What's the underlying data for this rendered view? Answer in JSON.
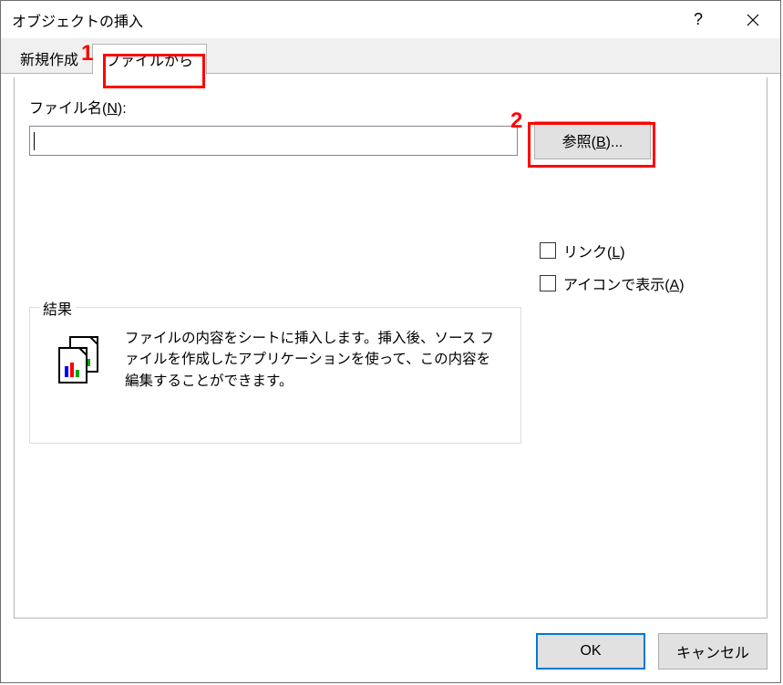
{
  "window": {
    "title": "オブジェクトの挿入",
    "help": "?",
    "close": "✕"
  },
  "tabs": {
    "new": "新規作成",
    "file": "ファイルから"
  },
  "filename": {
    "label_pre": "ファイル名(",
    "label_accel": "N",
    "label_post": "):",
    "value": ""
  },
  "browse": {
    "label_pre": "参照(",
    "label_accel": "B",
    "label_post": ")..."
  },
  "checkboxes": {
    "link_pre": "リンク(",
    "link_accel": "L",
    "link_post": ")",
    "icon_pre": "アイコンで表示(",
    "icon_accel": "A",
    "icon_post": ")"
  },
  "result": {
    "legend": "結果",
    "text": "ファイルの内容をシートに挿入します。挿入後、ソース ファイルを作成したアプリケーションを使って、この内容を編集することができます。"
  },
  "footer": {
    "ok": "OK",
    "cancel": "キャンセル"
  },
  "annotations": {
    "one": "1",
    "two": "2"
  }
}
